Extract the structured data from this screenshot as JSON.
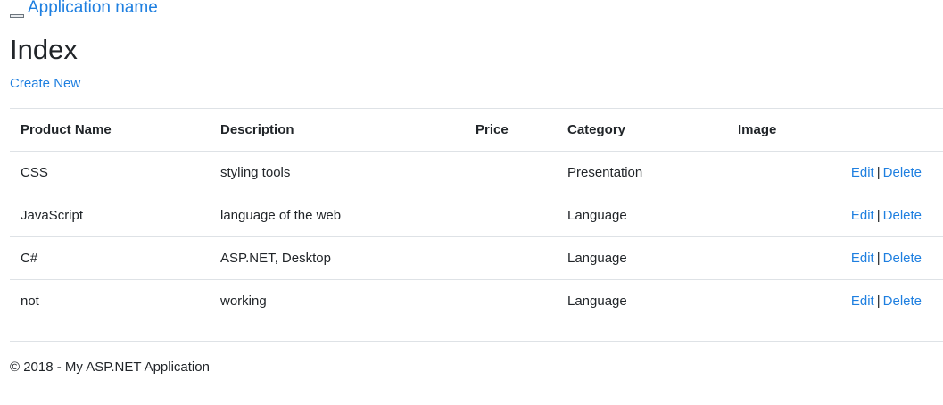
{
  "header": {
    "brand": "Application name"
  },
  "main": {
    "title": "Index",
    "create_link": "Create New",
    "table": {
      "columns": [
        "Product Name",
        "Description",
        "Price",
        "Category",
        "Image",
        ""
      ],
      "rows": [
        {
          "name": "CSS",
          "description": "styling tools",
          "price": "",
          "category": "Presentation",
          "image": "",
          "edit": "Edit",
          "sep": "|",
          "delete": "Delete"
        },
        {
          "name": "JavaScript",
          "description": "language of the web",
          "price": "",
          "category": "Language",
          "image": "",
          "edit": "Edit",
          "sep": "|",
          "delete": "Delete"
        },
        {
          "name": "C#",
          "description": "ASP.NET, Desktop",
          "price": "",
          "category": "Language",
          "image": "",
          "edit": "Edit",
          "sep": "|",
          "delete": "Delete"
        },
        {
          "name": "not",
          "description": "working",
          "price": "",
          "category": "Language",
          "image": "",
          "edit": "Edit",
          "sep": "|",
          "delete": "Delete"
        }
      ]
    }
  },
  "footer": {
    "text": "© 2018 - My ASP.NET Application"
  },
  "colors": {
    "link": "#1e7fe0",
    "text": "#212529",
    "rule": "#dee2e6"
  },
  "icons": {
    "nav_toggle": "broken-image-icon"
  }
}
